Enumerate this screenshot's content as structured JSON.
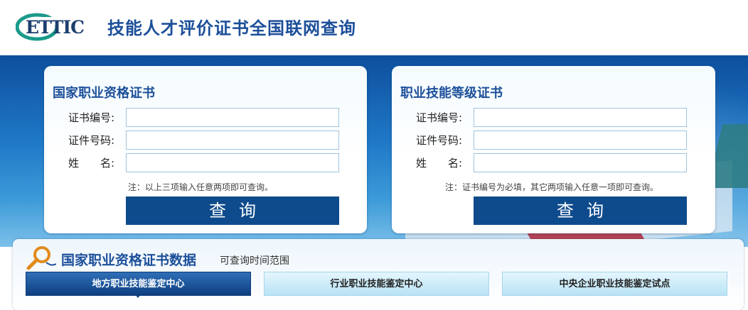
{
  "header": {
    "logo_text": "ETTIC",
    "title": "技能人才评价证书全国联网查询"
  },
  "cards": [
    {
      "title": "国家职业资格证书",
      "fields": [
        {
          "label": "证书编号:",
          "value": ""
        },
        {
          "label": "证件号码:",
          "value": ""
        },
        {
          "label": "姓　　名:",
          "value": ""
        }
      ],
      "note": "注：以上三项输入任意两项即可查询。",
      "button": "查询"
    },
    {
      "title": "职业技能等级证书",
      "fields": [
        {
          "label": "证书编号:",
          "value": ""
        },
        {
          "label": "证件号码:",
          "value": ""
        },
        {
          "label": "姓　　名:",
          "value": ""
        }
      ],
      "note": "注：证书编号为必填，其它两项输入任意一项即可查询。",
      "button": "查询"
    }
  ],
  "data_panel": {
    "title": "国家职业资格证书数据",
    "subtitle": "可查询时间范围",
    "tabs": [
      {
        "label": "地方职业技能鉴定中心",
        "active": true
      },
      {
        "label": "行业职业技能鉴定中心",
        "active": false
      },
      {
        "label": "中央企业职业技能鉴定试点",
        "active": false
      }
    ]
  },
  "colors": {
    "brand": "#1c4f9a",
    "button": "#0e4b8c",
    "logo_accent": "#1a9a8a"
  }
}
